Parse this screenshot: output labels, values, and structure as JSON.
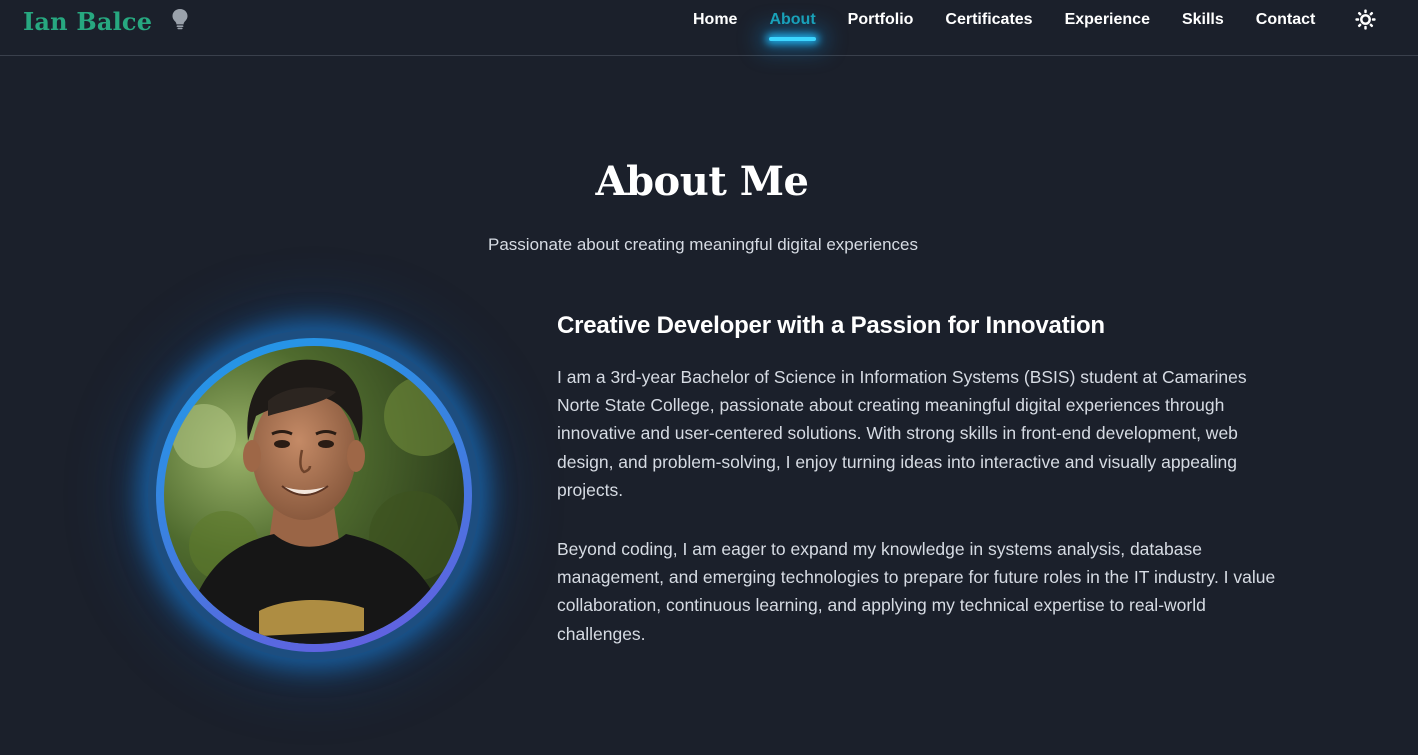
{
  "brand": {
    "name": "Ian Balce",
    "icon": "lightbulb-icon"
  },
  "nav": {
    "items": [
      {
        "label": "Home",
        "active": false
      },
      {
        "label": "About",
        "active": true
      },
      {
        "label": "Portfolio",
        "active": false
      },
      {
        "label": "Certificates",
        "active": false
      },
      {
        "label": "Experience",
        "active": false
      },
      {
        "label": "Skills",
        "active": false
      },
      {
        "label": "Contact",
        "active": false
      }
    ],
    "theme_toggle_icon": "sun-icon"
  },
  "about": {
    "title": "About Me",
    "subtitle": "Passionate about creating meaningful digital experiences",
    "heading": "Creative Developer with a Passion for Innovation",
    "paragraphs": [
      "I am a 3rd-year Bachelor of Science in Information Systems (BSIS) student at Camarines Norte State College, passionate about creating meaningful digital experiences through innovative and user-centered solutions. With strong skills in front-end development, web design, and problem-solving, I enjoy turning ideas into interactive and visually appealing projects.",
      "Beyond coding, I am eager to expand my knowledge in systems analysis, database management, and emerging technologies to prepare for future roles in the IT industry. I value collaboration, continuous learning, and applying my technical expertise to real-world challenges."
    ]
  },
  "colors": {
    "background": "#1b202b",
    "brand": "#27a880",
    "active_nav": "#1aa3b6",
    "glow": "#3cd6ff",
    "body_text": "#d6dbe3"
  }
}
